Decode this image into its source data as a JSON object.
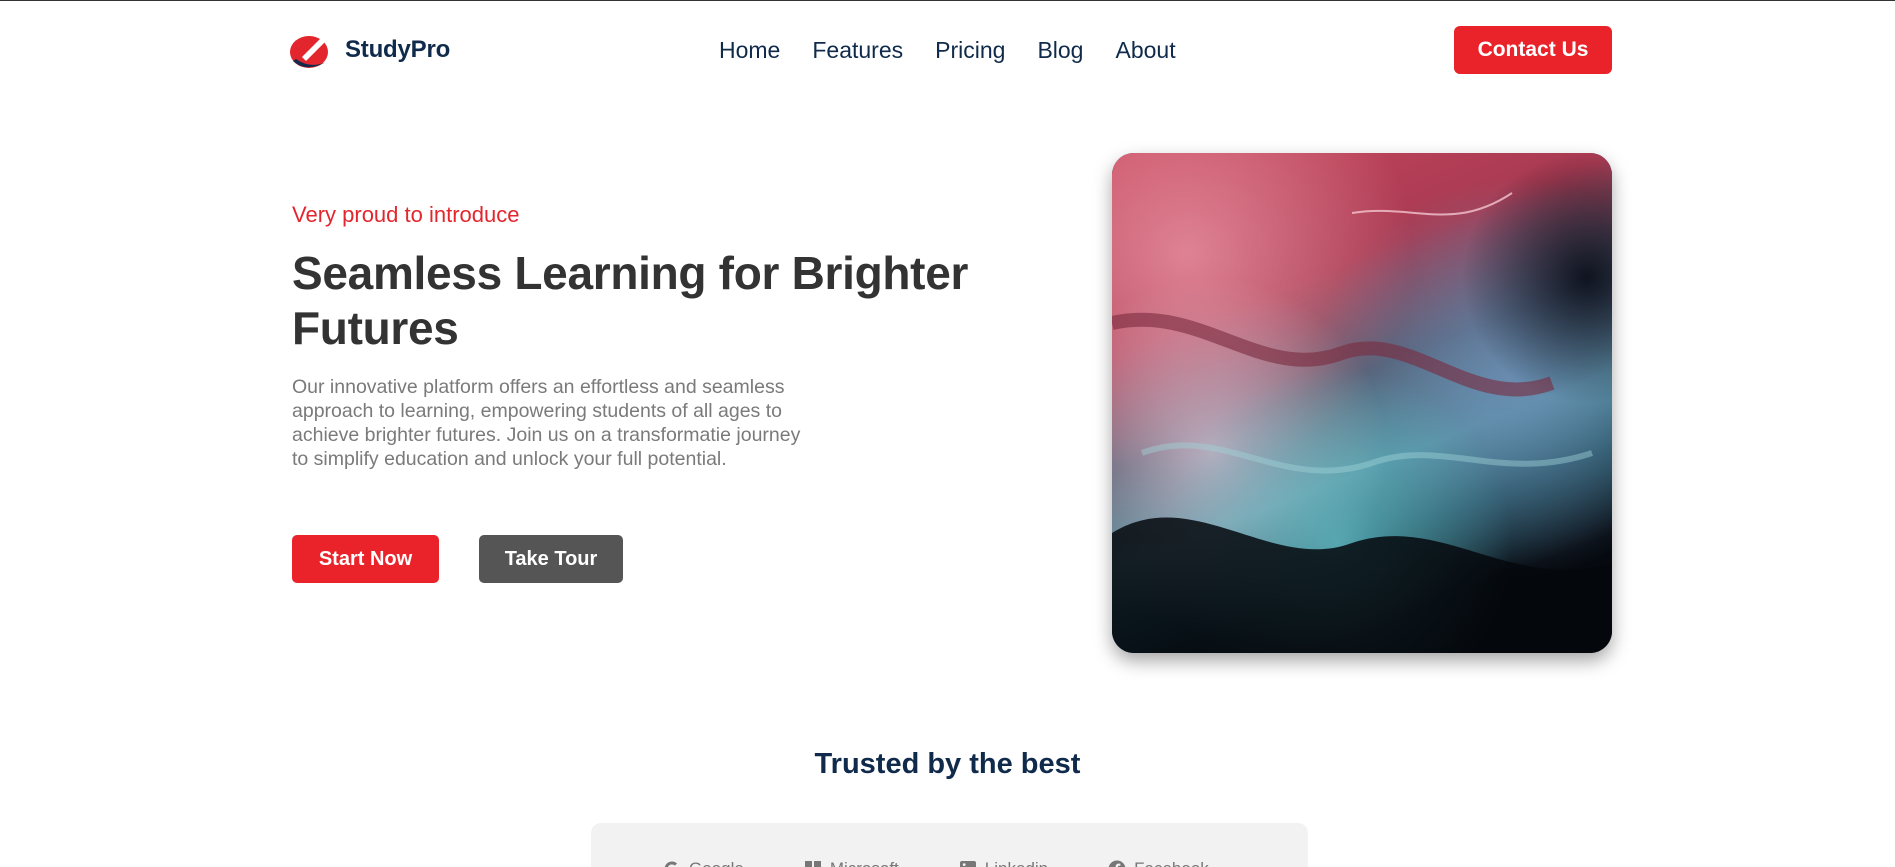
{
  "header": {
    "brand": "StudyPro",
    "nav": [
      "Home",
      "Features",
      "Pricing",
      "Blog",
      "About"
    ],
    "contact_label": "Contact Us"
  },
  "hero": {
    "eyebrow": "Very proud to introduce",
    "headline": "Seamless Learning for Brighter Futures",
    "lead": "Our innovative platform offers an effortless and seamless approach to learning, empowering students of all ages to achieve brighter futures. Join us on a transformatie journey to simplify education and unlock your full potential.",
    "start_label": "Start Now",
    "tour_label": "Take Tour"
  },
  "trusted": {
    "title": "Trusted by the best",
    "logos": [
      {
        "label": "Google",
        "icon": "google-icon"
      },
      {
        "label": "Microsoft",
        "icon": "microsoft-icon"
      },
      {
        "label": "Linkedin",
        "icon": "linkedin-icon"
      },
      {
        "label": "Facebook",
        "icon": "facebook-icon"
      }
    ]
  },
  "colors": {
    "accent": "#ea232b",
    "navy": "#0f2a4a",
    "secondary_button": "#555555"
  }
}
